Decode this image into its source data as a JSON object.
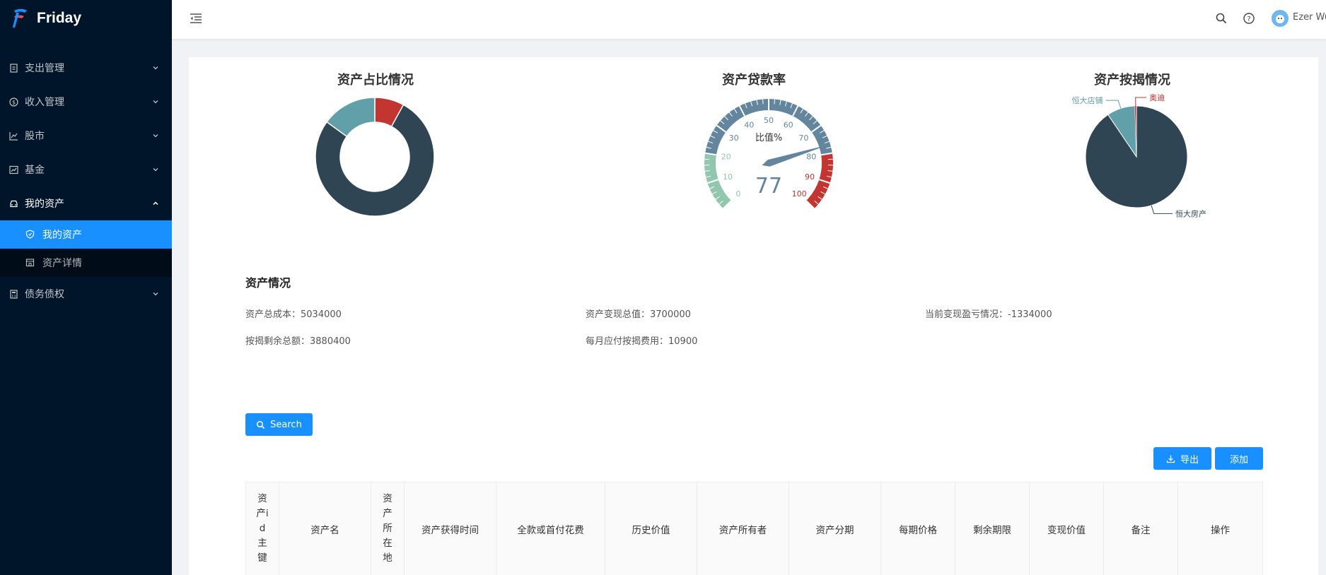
{
  "app": {
    "name": "Friday"
  },
  "sidebar": {
    "items": [
      {
        "label": "支出管理",
        "icon": "receipt-icon"
      },
      {
        "label": "收入管理",
        "icon": "dollar-circle-icon"
      },
      {
        "label": "股市",
        "icon": "line-chart-icon"
      },
      {
        "label": "基金",
        "icon": "stock-icon"
      },
      {
        "label": "我的资产",
        "icon": "car-icon",
        "open": true,
        "children": [
          {
            "label": "我的资产",
            "icon": "shield-icon",
            "active": true
          },
          {
            "label": "资产详情",
            "icon": "shop-icon"
          }
        ]
      },
      {
        "label": "债务债权",
        "icon": "calculator-icon"
      }
    ]
  },
  "header": {
    "user": "Ezer Wu"
  },
  "charts": {
    "ratio_title": "资产占比情况",
    "loan_title": "资产贷款率",
    "mortgage_title": "资产按揭情况"
  },
  "chart_data": [
    {
      "type": "pie",
      "title": "资产占比情况",
      "variant": "donut",
      "values": [
        8,
        77,
        15
      ],
      "colors": [
        "#c23531",
        "#2f4554",
        "#61a0a8"
      ]
    },
    {
      "type": "gauge",
      "title": "资产贷款率",
      "unit_label": "比值%",
      "value": 77,
      "min": 0,
      "max": 100,
      "ticks": [
        "0",
        "10",
        "20",
        "30",
        "40",
        "50",
        "60",
        "70",
        "80",
        "90",
        "100"
      ],
      "bands": [
        {
          "to": 20,
          "color": "#91c7ae"
        },
        {
          "to": 80,
          "color": "#63869e"
        },
        {
          "to": 100,
          "color": "#c23531"
        }
      ]
    },
    {
      "type": "pie",
      "title": "资产按揭情况",
      "categories": [
        "恒大房产",
        "恒大店铺",
        "奥迪"
      ],
      "values": [
        91,
        9,
        0.5
      ],
      "colors": [
        "#2f4554",
        "#61a0a8",
        "#c23531"
      ]
    }
  ],
  "summary": {
    "title": "资产情况",
    "total_cost": "资产总成本：5034000",
    "realized_total": "资产变现总值：3700000",
    "current_pnl": "当前变现盈亏情况：-1334000",
    "mortgage_remaining": "按揭剩余总额：3880400",
    "monthly_mortgage": "每月应付按揭费用：10900"
  },
  "buttons": {
    "search": "Search",
    "export": "导出",
    "add": "添加"
  },
  "table": {
    "headers": [
      "资产id主键",
      "资产名",
      "资产所在地",
      "资产获得时间",
      "全款或首付花费",
      "历史价值",
      "资产所有者",
      "资产分期",
      "每期价格",
      "剩余期限",
      "变现价值",
      "备注",
      "操作"
    ]
  },
  "colors": {
    "accent": "#1890ff",
    "sidebar_bg": "#001529"
  }
}
